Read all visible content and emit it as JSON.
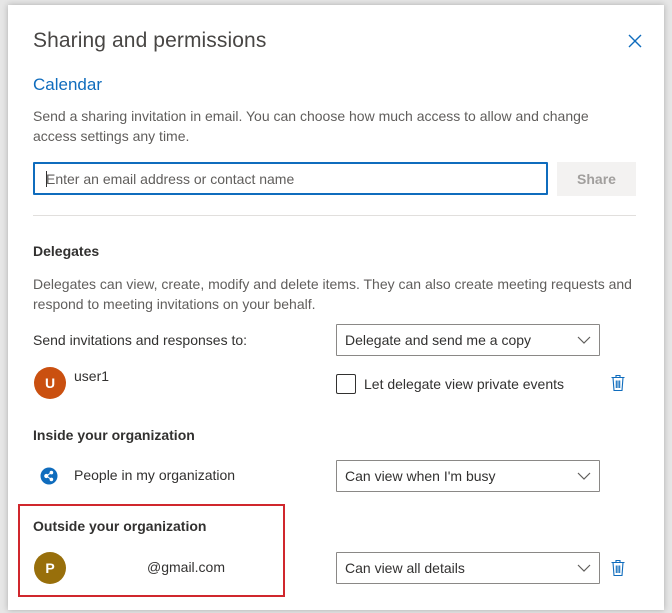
{
  "dialog": {
    "title": "Sharing and permissions",
    "calendar_title": "Calendar",
    "intro": "Send a sharing invitation in email. You can choose how much access to allow and change access settings any time.",
    "email_placeholder": "Enter an email address or contact name",
    "share_label": "Share"
  },
  "delegates": {
    "heading": "Delegates",
    "description": "Delegates can view, create, modify and delete items. They can also create meeting requests and respond to meeting invitations on your behalf.",
    "send_label": "Send invitations and responses to:",
    "send_option": "Delegate and send me a copy",
    "user": {
      "initial": "U",
      "name": "user1",
      "color": "#ca5010"
    },
    "private_label": "Let delegate view private events"
  },
  "inside": {
    "heading": "Inside your organization",
    "entity": "People in my organization",
    "permission": "Can view when I'm busy"
  },
  "outside": {
    "heading": "Outside your organization",
    "user": {
      "initial": "P",
      "email": "@gmail.com",
      "color": "#986f0b"
    },
    "permission": "Can view all details"
  },
  "colors": {
    "accent": "#0f6cbd",
    "highlight": "#d0272d",
    "trash": "#0f6cbd"
  }
}
